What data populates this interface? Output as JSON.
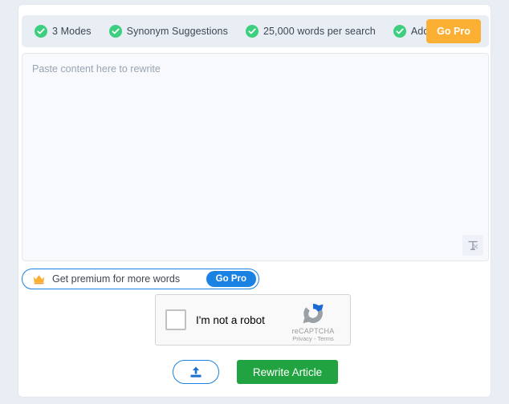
{
  "feature_bar": {
    "features": [
      {
        "label": "3 Modes",
        "icon": "check-circle-icon"
      },
      {
        "label": "Synonym Suggestions",
        "icon": "check-circle-icon"
      },
      {
        "label": "25,000 words per search",
        "icon": "check-circle-icon"
      },
      {
        "label": "Add Free",
        "icon": "check-circle-icon"
      }
    ],
    "go_pro_label": "Go Pro"
  },
  "editor": {
    "placeholder": "Paste content here to rewrite",
    "value": "",
    "grammar_tool_icon": "text-cursor-icon"
  },
  "premium_banner": {
    "icon": "crown-icon",
    "text": "Get premium for more words",
    "go_pro_label": "Go Pro"
  },
  "recaptcha": {
    "checkbox_label": "I'm not a robot",
    "brand_name": "reCAPTCHA",
    "brand_links": "Privacy - Terms",
    "logo_icon": "recaptcha-logo-icon"
  },
  "actions": {
    "upload_icon": "upload-icon",
    "rewrite_label": "Rewrite Article"
  },
  "colors": {
    "accent_green": "#3dcf7f",
    "go_pro_orange": "#fbb034",
    "go_pro_blue": "#1a82e2",
    "rewrite_green": "#22a341",
    "page_background": "#e9eef5",
    "editor_background": "#f7f9fc"
  }
}
